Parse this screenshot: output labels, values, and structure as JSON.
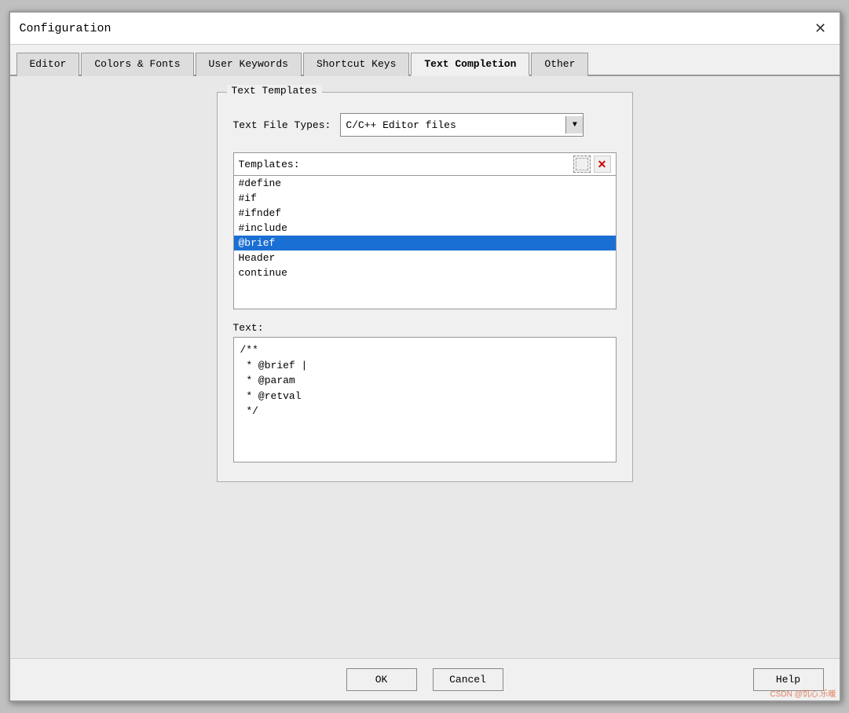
{
  "title": "Configuration",
  "tabs": [
    {
      "id": "editor",
      "label": "Editor",
      "active": false
    },
    {
      "id": "colors-fonts",
      "label": "Colors & Fonts",
      "active": false
    },
    {
      "id": "user-keywords",
      "label": "User Keywords",
      "active": false
    },
    {
      "id": "shortcut-keys",
      "label": "Shortcut Keys",
      "active": false
    },
    {
      "id": "text-completion",
      "label": "Text Completion",
      "active": true
    },
    {
      "id": "other",
      "label": "Other",
      "active": false
    }
  ],
  "group_box_label": "Text Templates",
  "file_types_label": "Text File Types:",
  "file_types_value": "C/C++ Editor files",
  "templates_label": "Templates:",
  "template_items": [
    {
      "id": "define",
      "label": "#define",
      "selected": false
    },
    {
      "id": "if",
      "label": "#if",
      "selected": false
    },
    {
      "id": "ifndef",
      "label": "#ifndef",
      "selected": false
    },
    {
      "id": "include",
      "label": "#include",
      "selected": false
    },
    {
      "id": "brief",
      "label": "@brief",
      "selected": true
    },
    {
      "id": "header",
      "label": "Header",
      "selected": false
    },
    {
      "id": "continue",
      "label": "continue",
      "selected": false
    }
  ],
  "text_label": "Text:",
  "text_content": "/**\n * @brief |\n * @param\n * @retval\n */",
  "buttons": {
    "ok": "OK",
    "cancel": "Cancel",
    "help": "Help"
  },
  "icons": {
    "new_template": "⊞",
    "delete_template": "✕",
    "dropdown": "▼"
  },
  "watermark": "CSDN @饥心.乐暖"
}
